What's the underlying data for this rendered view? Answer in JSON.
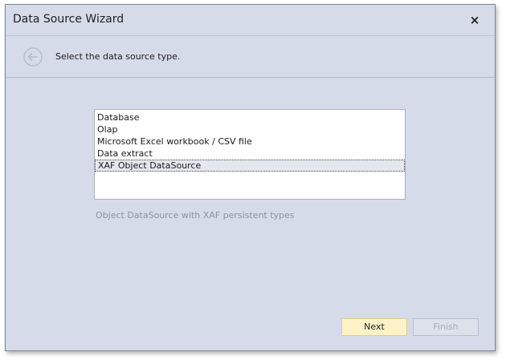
{
  "window": {
    "title": "Data Source Wizard",
    "close_glyph": "×"
  },
  "header": {
    "back_icon": "back-arrow-circle-icon",
    "instruction": "Select the data source type."
  },
  "list": {
    "items": [
      {
        "label": "Database",
        "selected": false
      },
      {
        "label": "Olap",
        "selected": false
      },
      {
        "label": "Microsoft Excel workbook / CSV file",
        "selected": false
      },
      {
        "label": "Data extract",
        "selected": false
      },
      {
        "label": "XAF Object DataSource",
        "selected": true
      }
    ]
  },
  "description": "Object DataSource with XAF persistent types",
  "buttons": {
    "next_label": "Next",
    "finish_label": "Finish"
  },
  "colors": {
    "window_background": "#d6dbe9",
    "next_button_background": "#fdf1c7",
    "disabled_text": "#a6abb6"
  }
}
